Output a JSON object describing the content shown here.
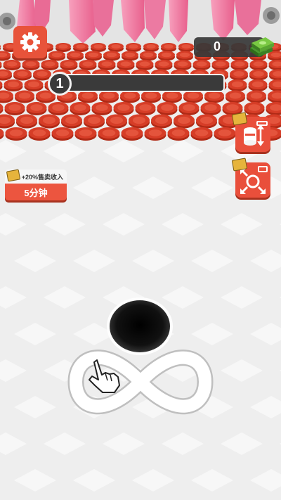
{
  "hud": {
    "money": "0",
    "level": "1",
    "level_progress": 0
  },
  "bonus": {
    "label": "+20%售卖收入",
    "duration": "5分钟"
  },
  "icons": {
    "settings": "gear-icon",
    "money": "cash-stack-icon",
    "upgrade_capacity": "capacity-upgrade-icon",
    "upgrade_size": "hole-size-upgrade-icon",
    "hint": "hand-pointer-icon"
  },
  "colors": {
    "accent_red": "#e94f3b",
    "coin_red": "#d63d27",
    "crystal_pink": "#f0789c",
    "floor": "#eeeeee",
    "hole": "#0a0a0a"
  }
}
